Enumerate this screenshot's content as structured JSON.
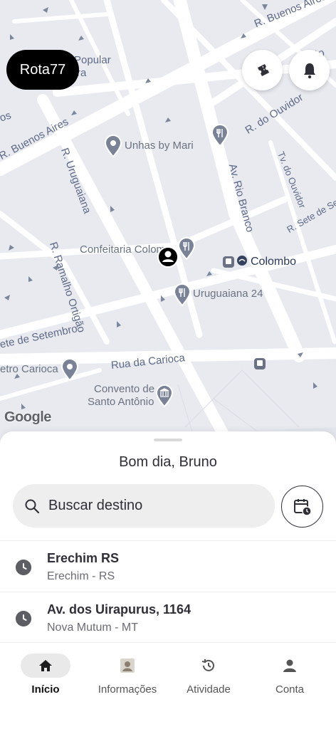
{
  "app": {
    "brand": "Rota77"
  },
  "header": {
    "ticket_icon": "ticket-icon",
    "bell_icon": "bell-icon"
  },
  "map": {
    "streets": [
      {
        "id": "buenos-aires-top",
        "text": "R. Buenos Aires"
      },
      {
        "id": "ario",
        "text": "ário"
      },
      {
        "id": "popular",
        "text": "Popular"
      },
      {
        "id": "popular-ra",
        "text": "ra"
      },
      {
        "id": "os",
        "text": "os"
      },
      {
        "id": "buenos-aires-left",
        "text": "R. Buenos Aires"
      },
      {
        "id": "ouvidor",
        "text": "R. do Ouvidor"
      },
      {
        "id": "uruguaiana",
        "text": "R. Uruguaiana"
      },
      {
        "id": "rio-branco",
        "text": "Av. Rio Branco"
      },
      {
        "id": "tv-ouvidor",
        "text": "Tv. do Ouvidor"
      },
      {
        "id": "sete-setembro-right",
        "text": "R. Sete de Sete"
      },
      {
        "id": "ramalho",
        "text": "R. Ramalho Ortigão"
      },
      {
        "id": "sete-setembro-left",
        "text": "ete de Setembro"
      },
      {
        "id": "carioca",
        "text": "Rua da Carioca"
      }
    ],
    "places": [
      {
        "id": "unhas",
        "text": "Unhas by Mari",
        "icon": "place-pin-icon"
      },
      {
        "id": "confeitaria",
        "text": "Confeitaria Colom",
        "icon": "restaurant-pin-icon"
      },
      {
        "id": "colombo",
        "text": "Colombo",
        "icon": "restaurant-icon"
      },
      {
        "id": "uruguaiana24",
        "text": "Uruguaiana 24",
        "icon": "restaurant-pin-icon"
      },
      {
        "id": "metro",
        "text": "etro Carioca",
        "icon": "place-pin-icon"
      },
      {
        "id": "convento1",
        "text": "Convento de",
        "icon": "museum-pin-icon"
      },
      {
        "id": "convento2",
        "text": "Santo Antônio",
        "icon": ""
      }
    ],
    "attribution": "Google"
  },
  "sheet": {
    "greeting": "Bom dia, Bruno",
    "search": {
      "placeholder": "Buscar destino",
      "icon": "search-icon"
    },
    "schedule_icon": "calendar-clock-icon",
    "recent": [
      {
        "title": "Erechim RS",
        "subtitle": "Erechim - RS",
        "icon": "clock-icon"
      },
      {
        "title": "Av. dos Uirapurus, 1164",
        "subtitle": "Nova Mutum - MT",
        "icon": "clock-icon"
      }
    ]
  },
  "nav": [
    {
      "label": "Início",
      "icon": "home-icon",
      "active": true
    },
    {
      "label": "Informações",
      "icon": "info-image-icon",
      "active": false
    },
    {
      "label": "Atividade",
      "icon": "history-icon",
      "active": false
    },
    {
      "label": "Conta",
      "icon": "person-icon",
      "active": false
    }
  ]
}
